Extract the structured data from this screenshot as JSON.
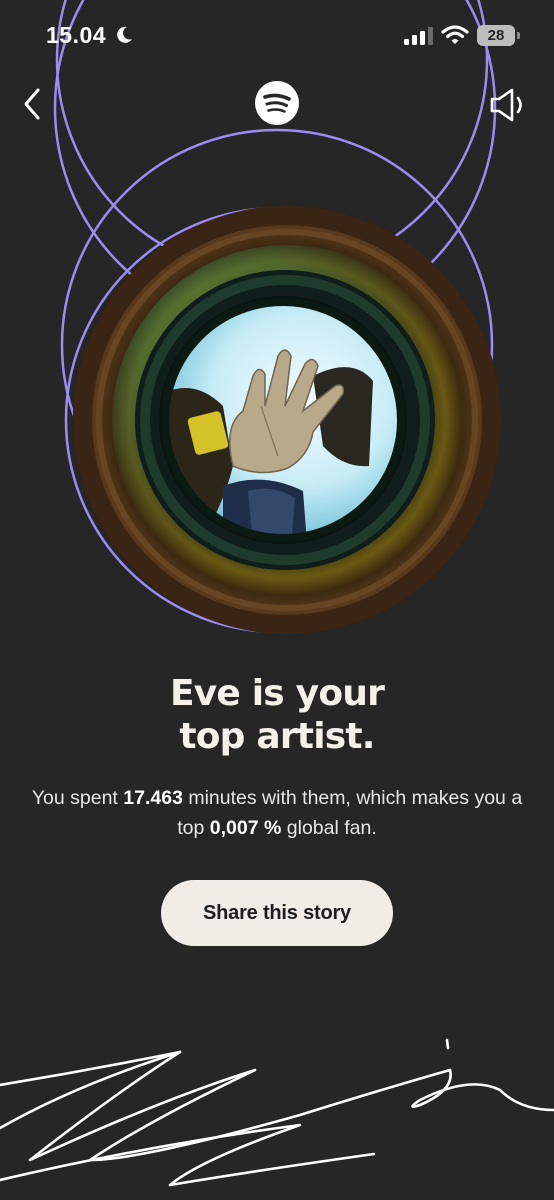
{
  "status_bar": {
    "time": "15.04",
    "battery": "28"
  },
  "nav": {
    "back_icon": "chevron-left-icon",
    "logo_icon": "spotify-logo-icon",
    "sound_icon": "speaker-icon"
  },
  "story": {
    "headline_line1": "Eve is your",
    "headline_line2": "top artist.",
    "sub_prefix": "You spent ",
    "minutes": "17.463",
    "sub_middle": " minutes with them, which makes you a top ",
    "percent": "0,007 %",
    "sub_suffix": " global fan."
  },
  "share": {
    "label": "Share this story"
  },
  "colors": {
    "background": "#262626",
    "accent_ring": "#9b8cf2",
    "button_bg": "#efede6"
  }
}
